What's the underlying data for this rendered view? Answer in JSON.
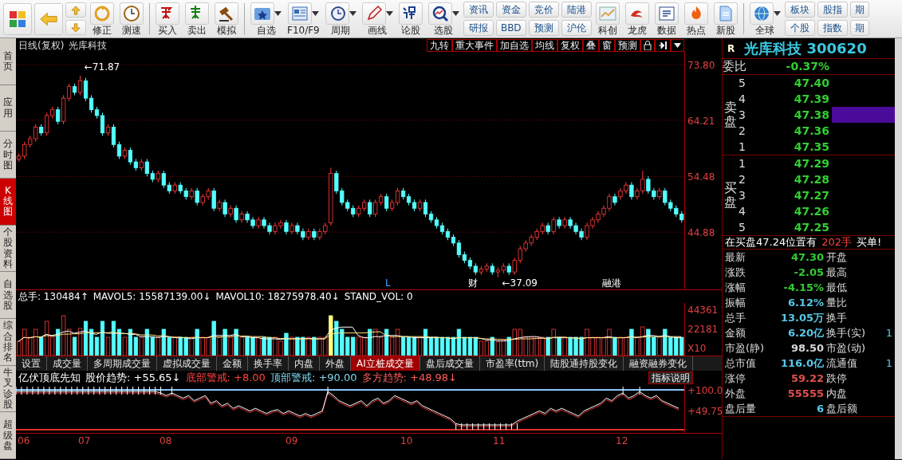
{
  "toolbar": {
    "items": [
      {
        "kind": "icon"
      },
      {
        "kind": "icon"
      },
      {
        "kind": "updown"
      },
      {
        "kind": "big",
        "label": "修正",
        "dropdown": false
      },
      {
        "kind": "big",
        "label": "测速",
        "dropdown": false
      },
      {
        "kind": "sep"
      },
      {
        "kind": "big",
        "label": "买入",
        "dropdown": false
      },
      {
        "kind": "big",
        "label": "卖出",
        "dropdown": false
      },
      {
        "kind": "big",
        "label": "模拟",
        "dropdown": false
      },
      {
        "kind": "sep"
      },
      {
        "kind": "big",
        "label": "自选",
        "dropdown": true
      },
      {
        "kind": "big",
        "label": "F10/F9",
        "dropdown": true
      },
      {
        "kind": "big",
        "label": "周期",
        "dropdown": true
      },
      {
        "kind": "big",
        "label": "画线",
        "dropdown": true
      },
      {
        "kind": "big",
        "label": "论股",
        "dropdown": false
      },
      {
        "kind": "big",
        "label": "选股",
        "dropdown": true
      },
      {
        "kind": "pair",
        "labels": [
          "资讯",
          "研报"
        ]
      },
      {
        "kind": "pair",
        "labels": [
          "资金",
          "BBD"
        ]
      },
      {
        "kind": "pair",
        "labels": [
          "竞价",
          "预测"
        ]
      },
      {
        "kind": "pair",
        "labels": [
          "陆港",
          "沪伦"
        ]
      },
      {
        "kind": "big",
        "label": "科创",
        "dropdown": false
      },
      {
        "kind": "big",
        "label": "龙虎",
        "dropdown": false
      },
      {
        "kind": "big",
        "label": "数据",
        "dropdown": false
      },
      {
        "kind": "big",
        "label": "热点",
        "dropdown": false
      },
      {
        "kind": "big",
        "label": "新股",
        "dropdown": false
      },
      {
        "kind": "sep"
      },
      {
        "kind": "big",
        "label": "全球",
        "dropdown": true
      },
      {
        "kind": "pair",
        "labels": [
          "板块",
          "个股"
        ]
      },
      {
        "kind": "pair",
        "labels": [
          "股指",
          "指数"
        ]
      },
      {
        "kind": "pair",
        "labels": [
          "期",
          "期"
        ]
      }
    ]
  },
  "side_tabs": [
    {
      "label": "首页",
      "selected": false
    },
    {
      "label": "应用",
      "selected": false
    },
    {
      "label": "分时图",
      "selected": false
    },
    {
      "label": "K线图",
      "selected": true
    },
    {
      "label": "个股资料",
      "selected": false
    },
    {
      "label": "自选股",
      "selected": false
    },
    {
      "label": "综合排名",
      "selected": false
    },
    {
      "label": "牛叉诊股",
      "selected": false
    },
    {
      "label": "超级盘",
      "selected": false
    }
  ],
  "chart": {
    "period": "日线(复权)",
    "stock_name": "光库科技",
    "buttons": [
      "九转",
      "重大事件",
      "加自选",
      "均线",
      "复权",
      "叠",
      "窗",
      "预测"
    ],
    "annotations": [
      "←71.87",
      "L",
      "财",
      "←37.09",
      "融港"
    ],
    "chart_data": {
      "type": "candlestick",
      "grid": true,
      "ylim": [
        35,
        76
      ],
      "yticks": [
        {
          "value": 73.8,
          "label": "73.80"
        },
        {
          "value": 64.21,
          "label": "64.21"
        },
        {
          "value": 54.48,
          "label": "54.48"
        },
        {
          "value": 44.88,
          "label": "44.88"
        }
      ],
      "ohlc": [
        [
          57.5,
          58.5,
          57,
          58
        ],
        [
          58,
          60.5,
          57.5,
          60
        ],
        [
          60,
          61.5,
          59.5,
          61
        ],
        [
          61,
          63.5,
          60.5,
          63
        ],
        [
          63,
          63.5,
          61.5,
          62
        ],
        [
          62,
          65.5,
          61.5,
          65
        ],
        [
          65,
          66.5,
          64.5,
          66
        ],
        [
          66,
          66.5,
          63.5,
          64
        ],
        [
          64,
          68.5,
          63.5,
          68
        ],
        [
          68,
          70.5,
          67.5,
          70
        ],
        [
          70,
          70.5,
          68.5,
          69
        ],
        [
          69,
          71.87,
          68.5,
          71
        ],
        [
          71,
          71.5,
          67.5,
          68
        ],
        [
          68,
          68.5,
          65.5,
          66
        ],
        [
          66,
          66.5,
          64.5,
          65
        ],
        [
          65,
          65.5,
          61.5,
          62
        ],
        [
          62,
          63.5,
          61.5,
          63
        ],
        [
          63,
          63.5,
          59.5,
          60
        ],
        [
          60,
          60.5,
          57.5,
          58
        ],
        [
          58,
          59.5,
          57.5,
          59
        ],
        [
          59,
          59.5,
          56.5,
          57
        ],
        [
          57,
          57.5,
          55.5,
          56
        ],
        [
          56,
          57.5,
          55.5,
          57
        ],
        [
          57,
          57.5,
          54.5,
          55
        ],
        [
          55,
          55.5,
          53.5,
          54
        ],
        [
          54,
          55.5,
          53.5,
          55
        ],
        [
          55,
          55.5,
          52.5,
          53
        ],
        [
          53,
          53.5,
          51.5,
          52
        ],
        [
          52,
          53.5,
          51.5,
          53
        ],
        [
          53,
          53.5,
          51.5,
          52
        ],
        [
          52,
          52.5,
          50.5,
          51
        ],
        [
          51,
          52.5,
          50.5,
          52
        ],
        [
          52,
          52.5,
          49.5,
          50
        ],
        [
          50,
          51.5,
          49.5,
          51
        ],
        [
          51,
          52.5,
          50.5,
          52
        ],
        [
          52,
          52.5,
          48.5,
          49
        ],
        [
          49,
          50.5,
          48.5,
          50
        ],
        [
          50,
          50.5,
          47.5,
          48
        ],
        [
          48,
          49.5,
          47.5,
          49
        ],
        [
          49,
          49.5,
          46.5,
          47
        ],
        [
          47,
          48.5,
          46.5,
          48
        ],
        [
          48,
          48.5,
          46.5,
          47
        ],
        [
          47,
          47.5,
          45.5,
          46
        ],
        [
          46,
          47.5,
          45.5,
          47
        ],
        [
          47,
          47.5,
          45.5,
          46
        ],
        [
          46,
          46.5,
          44.5,
          45
        ],
        [
          45,
          46.5,
          44.5,
          46
        ],
        [
          46,
          47,
          45.5,
          46.5
        ],
        [
          46.5,
          47,
          44.5,
          45
        ],
        [
          45,
          46.5,
          44.5,
          46
        ],
        [
          46,
          46.5,
          44.5,
          45
        ],
        [
          45,
          45.5,
          43.5,
          44
        ],
        [
          44,
          45.5,
          43.5,
          45
        ],
        [
          45,
          45.5,
          43.5,
          44
        ],
        [
          44,
          45.5,
          43.5,
          45
        ],
        [
          45,
          46.5,
          44.5,
          46
        ],
        [
          46.5,
          56,
          46,
          55
        ],
        [
          55,
          55.5,
          51.5,
          52
        ],
        [
          52,
          52.5,
          49.5,
          50
        ],
        [
          50,
          50.5,
          48.5,
          49
        ],
        [
          49,
          49.5,
          47.5,
          48
        ],
        [
          48,
          49.5,
          47.5,
          49
        ],
        [
          49,
          50.5,
          48.5,
          50
        ],
        [
          50,
          50.5,
          47.5,
          48
        ],
        [
          48,
          50.5,
          47.5,
          50
        ],
        [
          50,
          51.5,
          49.5,
          51
        ],
        [
          51,
          51.5,
          48.5,
          49
        ],
        [
          49,
          50.5,
          48.5,
          50
        ],
        [
          50,
          52.5,
          49.5,
          52
        ],
        [
          52,
          52.5,
          50.5,
          51
        ],
        [
          51,
          51.5,
          49.5,
          50
        ],
        [
          50,
          50.5,
          48.5,
          49
        ],
        [
          49,
          50.5,
          48.5,
          50
        ],
        [
          50,
          50.5,
          47.5,
          48
        ],
        [
          48,
          48.5,
          46.5,
          47
        ],
        [
          47,
          47.5,
          45.5,
          46
        ],
        [
          46,
          46.5,
          44.5,
          45
        ],
        [
          45,
          45.5,
          43.5,
          44
        ],
        [
          44,
          44.5,
          42.5,
          43
        ],
        [
          43,
          43.5,
          40.5,
          41
        ],
        [
          41,
          41.5,
          39.5,
          40
        ],
        [
          40,
          40.5,
          38.5,
          39
        ],
        [
          39,
          39.5,
          37.5,
          38
        ],
        [
          38,
          39,
          37.5,
          38.5
        ],
        [
          38.5,
          39.5,
          38,
          39
        ],
        [
          39,
          39.5,
          37.5,
          38
        ],
        [
          38,
          38.8,
          37.09,
          38.3
        ],
        [
          38.3,
          39.5,
          37.8,
          39
        ],
        [
          39,
          39.5,
          37.5,
          38
        ],
        [
          38,
          40.5,
          37.5,
          40
        ],
        [
          40,
          42.5,
          39.5,
          42
        ],
        [
          42,
          43.5,
          41.5,
          43
        ],
        [
          43,
          44.5,
          42.5,
          44
        ],
        [
          44,
          45.5,
          43.5,
          45
        ],
        [
          45,
          46.5,
          44.5,
          46
        ],
        [
          46,
          46.5,
          44.5,
          45
        ],
        [
          45,
          47.5,
          44.5,
          47
        ],
        [
          47,
          47.5,
          45.5,
          46
        ],
        [
          46,
          47.5,
          45.5,
          47
        ],
        [
          47,
          47.5,
          45.5,
          46
        ],
        [
          46,
          46.5,
          44.5,
          45
        ],
        [
          45,
          45.5,
          43.5,
          44
        ],
        [
          44,
          46.5,
          43.5,
          46
        ],
        [
          46,
          47.5,
          45.5,
          47
        ],
        [
          47,
          48.5,
          46.5,
          48
        ],
        [
          48,
          49.5,
          47.5,
          49
        ],
        [
          49,
          51.5,
          48.5,
          51
        ],
        [
          51,
          51.5,
          49.5,
          50
        ],
        [
          51,
          52.5,
          50.5,
          52
        ],
        [
          52,
          53.5,
          51.5,
          53
        ],
        [
          53,
          53.5,
          50.5,
          51
        ],
        [
          51,
          52.5,
          50.5,
          52
        ],
        [
          52,
          55.5,
          51.5,
          54
        ],
        [
          54,
          54.5,
          51.5,
          52
        ],
        [
          52,
          52.5,
          50.5,
          51
        ],
        [
          51,
          52.5,
          50.5,
          52
        ],
        [
          52,
          52.5,
          49.5,
          50
        ],
        [
          50,
          50.5,
          48.5,
          49
        ],
        [
          49,
          49.5,
          47.5,
          48
        ],
        [
          48,
          48.5,
          46.5,
          47
        ]
      ]
    }
  },
  "volume": {
    "header": [
      {
        "text": "总手: 130484↑",
        "color": "#ffffff"
      },
      {
        "text": "MAVOL5: 15587139.00↓",
        "color": "#ffffff"
      },
      {
        "text": "MAVOL10: 18275978.40↓",
        "color": "#ffffff"
      },
      {
        "text": "STAND_VOL: 0",
        "color": "#ffffff"
      }
    ],
    "axis_labels": [
      "44361",
      "22181",
      "X10"
    ]
  },
  "indicator_tabs": [
    {
      "label": "设置",
      "selected": false
    },
    {
      "label": "成交量",
      "selected": false
    },
    {
      "label": "多周期成交量",
      "selected": false
    },
    {
      "label": "虚拟成交量",
      "selected": false
    },
    {
      "label": "金额",
      "selected": false
    },
    {
      "label": "换手率",
      "selected": false
    },
    {
      "label": "内盘",
      "selected": false
    },
    {
      "label": "外盘",
      "selected": false
    },
    {
      "label": "AI立桩成交量",
      "selected": true
    },
    {
      "label": "盘后成交量",
      "selected": false
    },
    {
      "label": "市盈率(ttm)",
      "selected": false
    },
    {
      "label": "陆股通持股变化",
      "selected": false
    },
    {
      "label": "融资融券变化",
      "selected": false
    }
  ],
  "indicator": {
    "header": [
      {
        "text": "亿伏顶底先知",
        "color": "#ffffff"
      },
      {
        "text": "股价趋势: +55.65↓",
        "color": "#ffffff"
      },
      {
        "text": "底部警戒: +8.00",
        "color": "#ff4040"
      },
      {
        "text": "顶部警戒: +90.00",
        "color": "#7fd8f0"
      },
      {
        "text": "多方趋势: +48.98↓",
        "color": "#ff5a5a"
      }
    ],
    "help_button": "指标说明",
    "axis_labels": [
      "+100.0",
      "+49.75"
    ]
  },
  "date_axis": [
    "06",
    "07",
    "08",
    "09",
    "10",
    "11",
    "12"
  ],
  "quote": {
    "flag": "R",
    "title": "光库科技 300620",
    "ratio_label": "委比",
    "ratio": "-0.37%",
    "sell_label": "卖盘",
    "buy_label": "买盘",
    "sell": [
      {
        "level": "5",
        "price": "47.40",
        "highlighted": false
      },
      {
        "level": "4",
        "price": "47.39",
        "highlighted": false
      },
      {
        "level": "3",
        "price": "47.38",
        "highlighted": true
      },
      {
        "level": "2",
        "price": "47.36",
        "highlighted": false
      },
      {
        "level": "1",
        "price": "47.35",
        "highlighted": false
      }
    ],
    "buy": [
      {
        "level": "1",
        "price": "47.29",
        "highlighted": false
      },
      {
        "level": "2",
        "price": "47.28",
        "highlighted": false
      },
      {
        "level": "3",
        "price": "47.27",
        "highlighted": false
      },
      {
        "level": "4",
        "price": "47.26",
        "highlighted": false
      },
      {
        "level": "5",
        "price": "47.25",
        "highlighted": false
      }
    ],
    "notice": [
      {
        "text": "在买盘47.24位置有",
        "color": "#ffffff"
      },
      {
        "text": "202手",
        "color": "#ff4040"
      },
      {
        "text": "买单!",
        "color": "#ffffff"
      }
    ],
    "stats": [
      {
        "label": "最新",
        "value": "47.30",
        "color": "#33cc33",
        "label2": "开盘"
      },
      {
        "label": "涨跌",
        "value": "-2.05",
        "color": "#33cc33",
        "label2": "最高"
      },
      {
        "label": "涨幅",
        "value": "-4.15%",
        "color": "#33cc33",
        "label2": "最低"
      },
      {
        "label": "振幅",
        "value": "6.12%",
        "color": "#58c8e8",
        "label2": "量比"
      },
      {
        "label": "总手",
        "value": "13.05万",
        "color": "#58c8e8",
        "label2": "换手"
      },
      {
        "label": "金额",
        "value": "6.20亿",
        "color": "#58c8e8",
        "label2": "换手(实)",
        "value2": "1"
      },
      {
        "label": "市盈(静)",
        "value": "98.50",
        "color": "#d8d8d8",
        "label2": "市盈(动)"
      },
      {
        "label": "总市值",
        "value": "116.0亿",
        "color": "#58c8e8",
        "label2": "流通值",
        "value2": "1"
      },
      {
        "label": "涨停",
        "value": "59.22",
        "color": "#e05050",
        "label2": "跌停"
      },
      {
        "label": "外盘",
        "value": "55555",
        "color": "#e05050",
        "label2": "内盘"
      },
      {
        "label": "盘后量",
        "value": "6",
        "color": "#58c8e8",
        "label2": "盘后额"
      }
    ]
  }
}
